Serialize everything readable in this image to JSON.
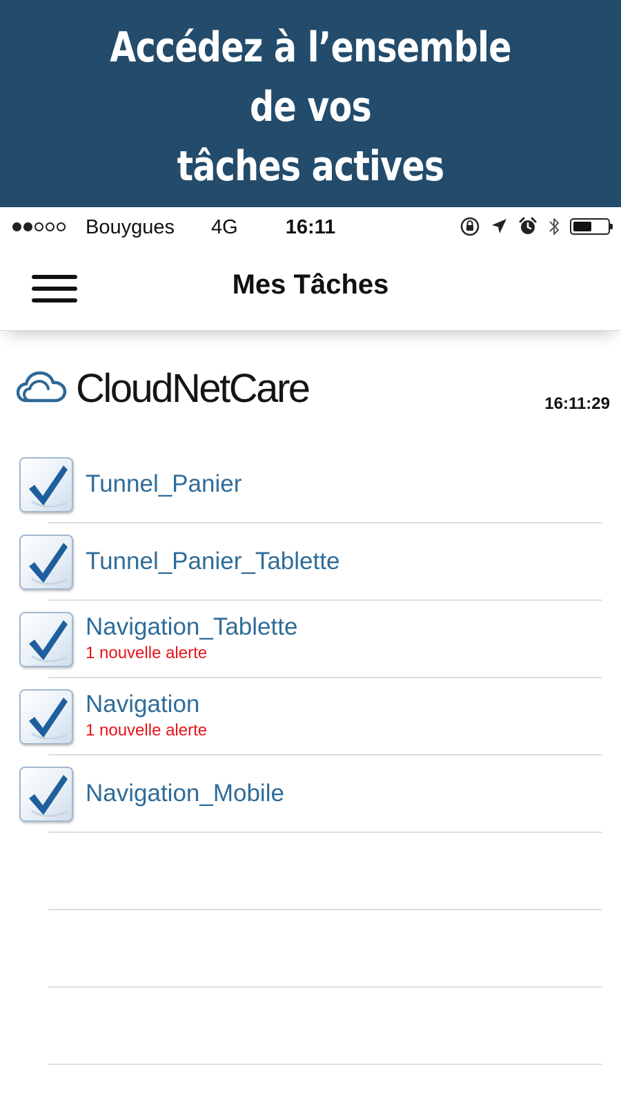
{
  "banner": {
    "lines": [
      "Accédez à l’ensemble",
      "de vos",
      "tâches actives"
    ]
  },
  "status_bar": {
    "signal_bars_filled": 2,
    "signal_bars_total": 5,
    "carrier": "Bouygues",
    "network": "4G",
    "time": "16:11",
    "icons": [
      "orientation-lock-icon",
      "location-arrow-icon",
      "alarm-icon",
      "bluetooth-icon",
      "battery-icon"
    ],
    "battery_level": 0.55
  },
  "nav": {
    "menu_icon": "hamburger-menu-icon",
    "title": "Mes Tâches"
  },
  "brand": {
    "logo_icon": "cloud-icon",
    "name": "CloudNetCare",
    "logo_color": "#2c6797"
  },
  "timestamp": "16:11:29",
  "tasks": [
    {
      "name": "Tunnel_Panier",
      "checked": true,
      "alert": ""
    },
    {
      "name": "Tunnel_Panier_Tablette",
      "checked": true,
      "alert": ""
    },
    {
      "name": "Navigation_Tablette",
      "checked": true,
      "alert": "1 nouvelle alerte"
    },
    {
      "name": "Navigation",
      "checked": true,
      "alert": "1 nouvelle alerte"
    },
    {
      "name": "Navigation_Mobile",
      "checked": true,
      "alert": ""
    }
  ],
  "empty_rows": 3,
  "colors": {
    "banner_bg": "#234b6b",
    "task_text": "#2f6c99",
    "alert_text": "#e8141b",
    "checkmark": "#1f5f9d"
  }
}
